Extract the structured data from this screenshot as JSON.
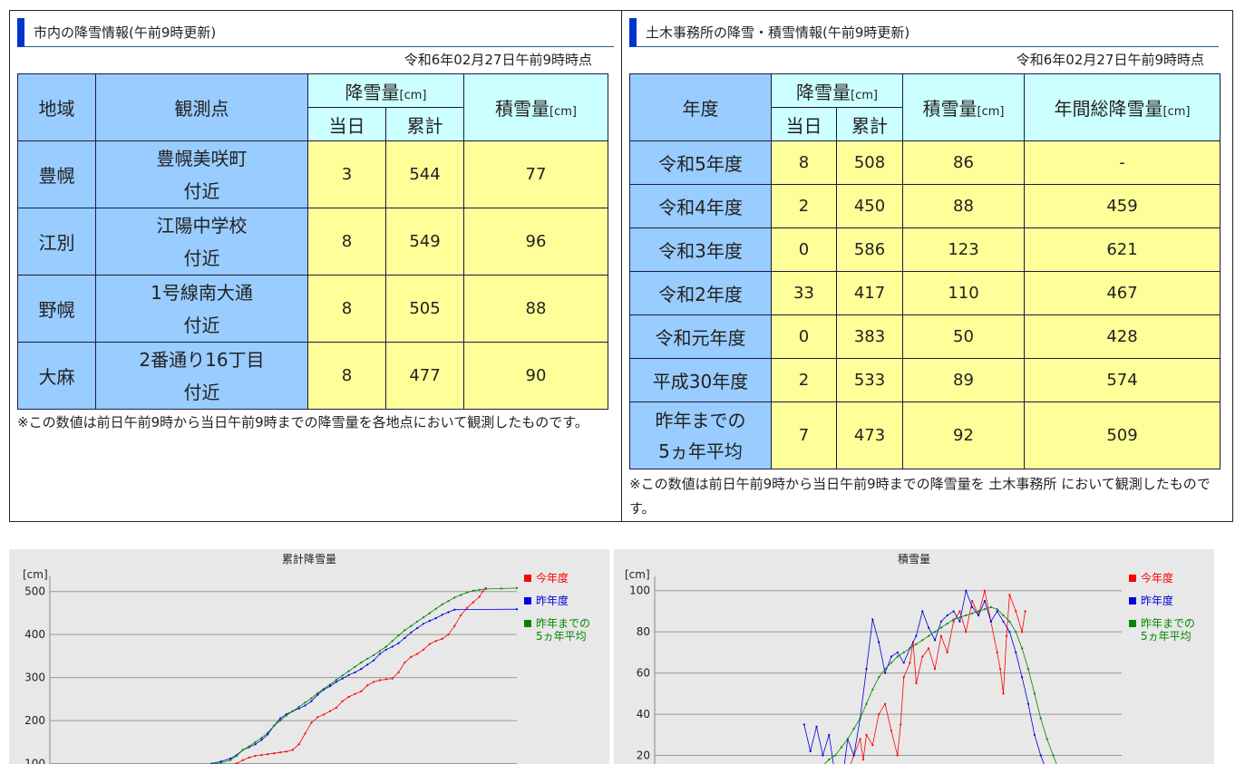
{
  "left_panel": {
    "title": "市内の降雪情報(午前9時更新)",
    "as_of": "令和6年02月27日午前9時時点",
    "headers": {
      "area": "地域",
      "point": "観測点",
      "snowfall": "降雪量",
      "snowfall_unit": "[cm]",
      "today": "当日",
      "total": "累計",
      "depth": "積雪量",
      "depth_unit": "[cm]"
    },
    "rows": [
      {
        "area": "豊幌",
        "point": "豊幌美咲町\n付近",
        "today": "3",
        "total": "544",
        "depth": "77"
      },
      {
        "area": "江別",
        "point": "江陽中学校\n付近",
        "today": "8",
        "total": "549",
        "depth": "96"
      },
      {
        "area": "野幌",
        "point": "1号線南大通\n付近",
        "today": "8",
        "total": "505",
        "depth": "88"
      },
      {
        "area": "大麻",
        "point": "2番通り16丁目\n付近",
        "today": "8",
        "total": "477",
        "depth": "90"
      }
    ],
    "note": "※この数値は前日午前9時から当日午前9時までの降雪量を各地点において観測したものです。"
  },
  "right_panel": {
    "title": "土木事務所の降雪・積雪情報(午前9時更新)",
    "as_of": "令和6年02月27日午前9時時点",
    "headers": {
      "year": "年度",
      "snowfall": "降雪量",
      "snowfall_unit": "[cm]",
      "today": "当日",
      "total": "累計",
      "depth": "積雪量",
      "depth_unit": "[cm]",
      "annual": "年間総降雪量",
      "annual_unit": "[cm]"
    },
    "rows": [
      {
        "year": "令和5年度",
        "today": "8",
        "total": "508",
        "depth": "86",
        "annual": "-"
      },
      {
        "year": "令和4年度",
        "today": "2",
        "total": "450",
        "depth": "88",
        "annual": "459"
      },
      {
        "year": "令和3年度",
        "today": "0",
        "total": "586",
        "depth": "123",
        "annual": "621"
      },
      {
        "year": "令和2年度",
        "today": "33",
        "total": "417",
        "depth": "110",
        "annual": "467"
      },
      {
        "year": "令和元年度",
        "today": "0",
        "total": "383",
        "depth": "50",
        "annual": "428"
      },
      {
        "year": "平成30年度",
        "today": "2",
        "total": "533",
        "depth": "89",
        "annual": "574"
      },
      {
        "year": "昨年までの\n5ヵ年平均",
        "today": "7",
        "total": "473",
        "depth": "92",
        "annual": "509"
      }
    ],
    "note": "※この数値は前日午前9時から当日午前9時までの降雪量を 土木事務所 において観測したものです。"
  },
  "colors": {
    "this_year": "#ff0000",
    "last_year": "#0000dd",
    "five_year_avg": "#008800"
  },
  "chart_data": [
    {
      "type": "line",
      "title": "累計降雪量",
      "ylabel": "[cm]",
      "yticks": [
        100,
        200,
        300,
        400,
        500
      ],
      "ylim": [
        0,
        550
      ],
      "xlim": [
        0,
        150
      ],
      "legend": "right",
      "grid": true,
      "series": [
        {
          "name": "今年度",
          "color": "#ff0000",
          "points": [
            [
              55,
              92
            ],
            [
              58,
              96
            ],
            [
              60,
              100
            ],
            [
              62,
              108
            ],
            [
              64,
              114
            ],
            [
              66,
              118
            ],
            [
              68,
              120
            ],
            [
              70,
              122
            ],
            [
              72,
              124
            ],
            [
              74,
              126
            ],
            [
              76,
              128
            ],
            [
              78,
              132
            ],
            [
              80,
              145
            ],
            [
              82,
              170
            ],
            [
              84,
              195
            ],
            [
              86,
              208
            ],
            [
              88,
              214
            ],
            [
              90,
              222
            ],
            [
              92,
              230
            ],
            [
              94,
              245
            ],
            [
              96,
              255
            ],
            [
              98,
              262
            ],
            [
              100,
              268
            ],
            [
              102,
              282
            ],
            [
              104,
              290
            ],
            [
              106,
              294
            ],
            [
              108,
              296
            ],
            [
              110,
              298
            ],
            [
              112,
              312
            ],
            [
              114,
              335
            ],
            [
              116,
              348
            ],
            [
              118,
              355
            ],
            [
              120,
              365
            ],
            [
              122,
              378
            ],
            [
              124,
              385
            ],
            [
              126,
              390
            ],
            [
              128,
              400
            ],
            [
              130,
              420
            ],
            [
              132,
              445
            ],
            [
              134,
              462
            ],
            [
              136,
              475
            ],
            [
              138,
              488
            ],
            [
              139,
              500
            ],
            [
              140,
              508
            ]
          ]
        },
        {
          "name": "昨年度",
          "color": "#0000dd",
          "points": [
            [
              52,
              100
            ],
            [
              55,
              105
            ],
            [
              58,
              112
            ],
            [
              60,
              120
            ],
            [
              62,
              132
            ],
            [
              64,
              138
            ],
            [
              66,
              145
            ],
            [
              68,
              155
            ],
            [
              70,
              168
            ],
            [
              72,
              188
            ],
            [
              74,
              205
            ],
            [
              76,
              215
            ],
            [
              78,
              222
            ],
            [
              80,
              228
            ],
            [
              82,
              235
            ],
            [
              84,
              245
            ],
            [
              86,
              260
            ],
            [
              88,
              272
            ],
            [
              90,
              280
            ],
            [
              92,
              290
            ],
            [
              94,
              298
            ],
            [
              96,
              306
            ],
            [
              98,
              312
            ],
            [
              100,
              320
            ],
            [
              102,
              330
            ],
            [
              104,
              340
            ],
            [
              106,
              355
            ],
            [
              108,
              365
            ],
            [
              110,
              372
            ],
            [
              112,
              380
            ],
            [
              114,
              392
            ],
            [
              116,
              405
            ],
            [
              118,
              415
            ],
            [
              120,
              425
            ],
            [
              122,
              432
            ],
            [
              124,
              438
            ],
            [
              126,
              446
            ],
            [
              128,
              452
            ],
            [
              130,
              458
            ],
            [
              150,
              459
            ]
          ]
        },
        {
          "name": "昨年までの\n5ヵ年平均",
          "color": "#008800",
          "points": [
            [
              52,
              98
            ],
            [
              55,
              102
            ],
            [
              58,
              108
            ],
            [
              60,
              118
            ],
            [
              62,
              132
            ],
            [
              64,
              140
            ],
            [
              66,
              150
            ],
            [
              68,
              160
            ],
            [
              70,
              172
            ],
            [
              72,
              188
            ],
            [
              74,
              200
            ],
            [
              76,
              212
            ],
            [
              78,
              222
            ],
            [
              80,
              232
            ],
            [
              82,
              242
            ],
            [
              84,
              252
            ],
            [
              86,
              264
            ],
            [
              88,
              274
            ],
            [
              90,
              284
            ],
            [
              92,
              295
            ],
            [
              94,
              305
            ],
            [
              96,
              315
            ],
            [
              98,
              325
            ],
            [
              100,
              335
            ],
            [
              102,
              344
            ],
            [
              104,
              352
            ],
            [
              106,
              362
            ],
            [
              108,
              372
            ],
            [
              110,
              385
            ],
            [
              112,
              398
            ],
            [
              114,
              410
            ],
            [
              116,
              420
            ],
            [
              118,
              430
            ],
            [
              120,
              440
            ],
            [
              122,
              450
            ],
            [
              124,
              460
            ],
            [
              126,
              470
            ],
            [
              128,
              478
            ],
            [
              130,
              486
            ],
            [
              132,
              492
            ],
            [
              134,
              498
            ],
            [
              136,
              502
            ],
            [
              138,
              504
            ],
            [
              140,
              506
            ],
            [
              145,
              507
            ],
            [
              150,
              508
            ]
          ]
        }
      ]
    },
    {
      "type": "line",
      "title": "積雪量",
      "ylabel": "[cm]",
      "yticks": [
        20,
        40,
        60,
        80,
        100
      ],
      "ylim": [
        0,
        110
      ],
      "xlim": [
        0,
        150
      ],
      "legend": "right",
      "grid": true,
      "series": [
        {
          "name": "今年度",
          "color": "#ff0000",
          "points": [
            [
              62,
              12
            ],
            [
              64,
              20
            ],
            [
              66,
              28
            ],
            [
              67,
              18
            ],
            [
              68,
              30
            ],
            [
              70,
              25
            ],
            [
              72,
              40
            ],
            [
              74,
              45
            ],
            [
              76,
              32
            ],
            [
              78,
              20
            ],
            [
              79,
              35
            ],
            [
              80,
              58
            ],
            [
              82,
              65
            ],
            [
              83,
              75
            ],
            [
              84,
              55
            ],
            [
              86,
              68
            ],
            [
              88,
              72
            ],
            [
              90,
              62
            ],
            [
              92,
              78
            ],
            [
              94,
              70
            ],
            [
              96,
              85
            ],
            [
              98,
              90
            ],
            [
              100,
              80
            ],
            [
              102,
              95
            ],
            [
              104,
              88
            ],
            [
              106,
              100
            ],
            [
              108,
              85
            ],
            [
              110,
              70
            ],
            [
              111,
              62
            ],
            [
              112,
              50
            ],
            [
              113,
              78
            ],
            [
              114,
              98
            ],
            [
              116,
              90
            ],
            [
              118,
              80
            ],
            [
              119,
              90
            ]
          ]
        },
        {
          "name": "昨年度",
          "color": "#0000dd",
          "points": [
            [
              48,
              35
            ],
            [
              50,
              22
            ],
            [
              52,
              34
            ],
            [
              54,
              20
            ],
            [
              56,
              30
            ],
            [
              58,
              10
            ],
            [
              60,
              5
            ],
            [
              62,
              28
            ],
            [
              64,
              20
            ],
            [
              66,
              38
            ],
            [
              68,
              62
            ],
            [
              70,
              86
            ],
            [
              72,
              75
            ],
            [
              74,
              60
            ],
            [
              76,
              68
            ],
            [
              78,
              70
            ],
            [
              80,
              65
            ],
            [
              82,
              72
            ],
            [
              84,
              78
            ],
            [
              86,
              90
            ],
            [
              88,
              82
            ],
            [
              90,
              76
            ],
            [
              92,
              85
            ],
            [
              94,
              88
            ],
            [
              96,
              90
            ],
            [
              98,
              85
            ],
            [
              100,
              100
            ],
            [
              102,
              92
            ],
            [
              104,
              88
            ],
            [
              106,
              95
            ],
            [
              108,
              85
            ],
            [
              110,
              90
            ],
            [
              112,
              85
            ],
            [
              114,
              80
            ],
            [
              116,
              70
            ],
            [
              118,
              58
            ],
            [
              120,
              45
            ],
            [
              122,
              30
            ],
            [
              124,
              20
            ],
            [
              126,
              12
            ],
            [
              128,
              5
            ]
          ]
        },
        {
          "name": "昨年までの\n5ヵ年平均",
          "color": "#008800",
          "points": [
            [
              54,
              15
            ],
            [
              56,
              18
            ],
            [
              58,
              20
            ],
            [
              60,
              24
            ],
            [
              62,
              28
            ],
            [
              64,
              33
            ],
            [
              66,
              38
            ],
            [
              68,
              45
            ],
            [
              70,
              52
            ],
            [
              72,
              58
            ],
            [
              74,
              62
            ],
            [
              76,
              65
            ],
            [
              78,
              68
            ],
            [
              80,
              70
            ],
            [
              82,
              72
            ],
            [
              84,
              74
            ],
            [
              86,
              76
            ],
            [
              88,
              78
            ],
            [
              90,
              80
            ],
            [
              92,
              82
            ],
            [
              94,
              84
            ],
            [
              96,
              86
            ],
            [
              98,
              87
            ],
            [
              100,
              88
            ],
            [
              102,
              89
            ],
            [
              104,
              90
            ],
            [
              106,
              91
            ],
            [
              108,
              92
            ],
            [
              110,
              91
            ],
            [
              112,
              88
            ],
            [
              114,
              85
            ],
            [
              116,
              80
            ],
            [
              118,
              72
            ],
            [
              120,
              62
            ],
            [
              122,
              50
            ],
            [
              124,
              38
            ],
            [
              126,
              28
            ],
            [
              128,
              20
            ],
            [
              130,
              12
            ]
          ]
        }
      ]
    }
  ]
}
